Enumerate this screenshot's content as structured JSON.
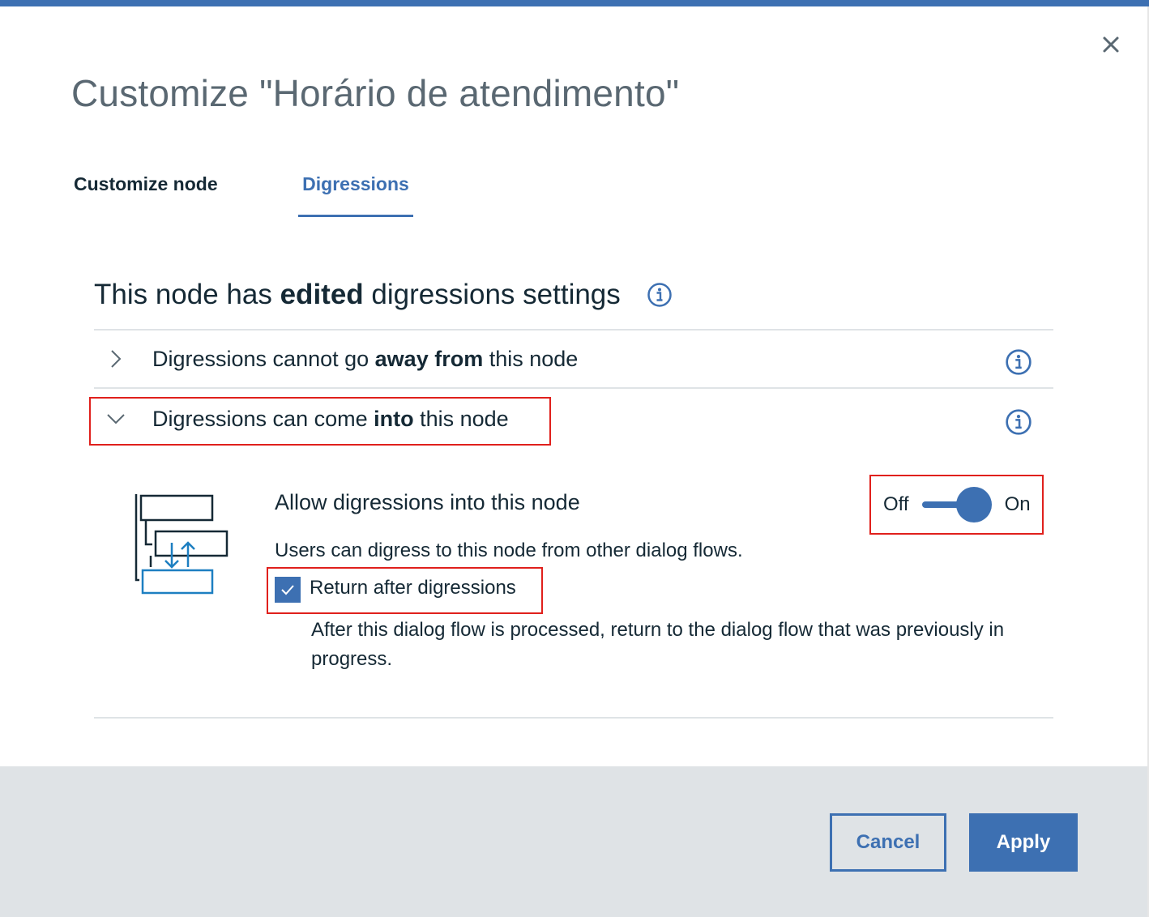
{
  "dialog": {
    "title": "Customize \"Horário de atendimento\"",
    "close_icon": "close-icon"
  },
  "tabs": [
    {
      "label": "Customize node",
      "active": false
    },
    {
      "label": "Digressions",
      "active": true
    }
  ],
  "heading": {
    "prefix": "This node has ",
    "emphasis": "edited",
    "suffix": " digressions settings",
    "icon": "info-icon"
  },
  "sections": [
    {
      "prefix": "Digressions cannot go ",
      "emphasis": "away from",
      "suffix": " this node",
      "expanded": false,
      "chevron": "chevron-right-icon",
      "info_icon": "info-icon"
    },
    {
      "prefix": "Digressions can come ",
      "emphasis": "into",
      "suffix": " this node",
      "expanded": true,
      "chevron": "chevron-down-icon",
      "info_icon": "info-icon"
    }
  ],
  "into_settings": {
    "diagram_icon": "dialog-flow-diagram-icon",
    "allow_label": "Allow digressions into this node",
    "toggle": {
      "off_label": "Off",
      "on_label": "On",
      "state": "on"
    },
    "description": "Users can digress to this node from other dialog flows.",
    "return_checkbox": {
      "label": "Return after digressions",
      "checked": true
    },
    "return_description": "After this dialog flow is processed, return to the dialog flow that was previously in progress."
  },
  "footer": {
    "cancel_label": "Cancel",
    "apply_label": "Apply"
  },
  "colors": {
    "accent": "#3d70b2",
    "title_text": "#5a6872",
    "body_text": "#152935",
    "footer_bg": "#dfe3e6",
    "highlight": "#e0201c"
  }
}
